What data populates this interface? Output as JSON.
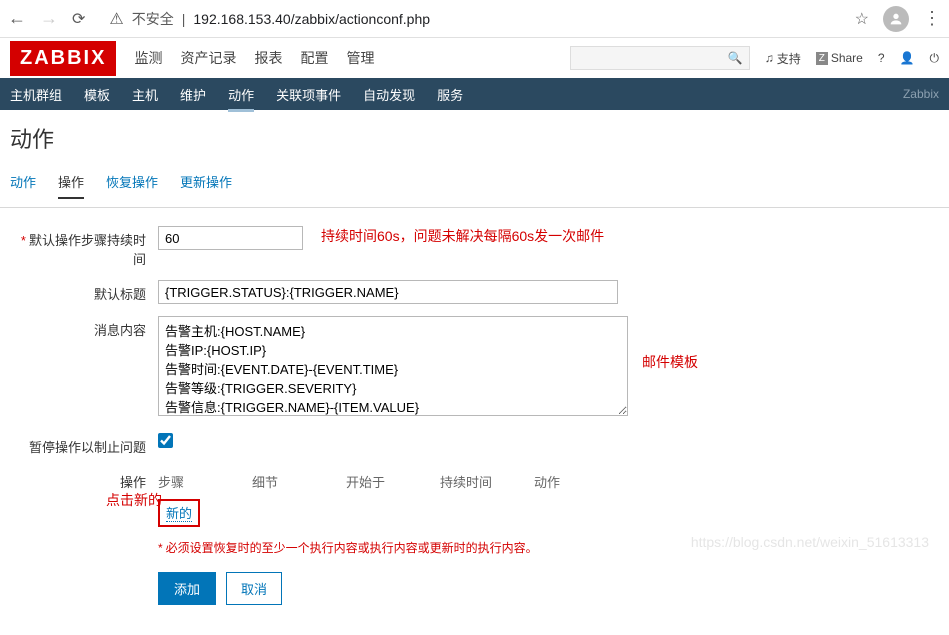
{
  "browser": {
    "security_label": "不安全",
    "url": "192.168.153.40/zabbix/actionconf.php"
  },
  "header": {
    "logo": "ZABBIX",
    "nav": [
      "监测",
      "资产记录",
      "报表",
      "配置",
      "管理"
    ],
    "support": "支持",
    "share": "Share"
  },
  "subnav": {
    "items": [
      "主机群组",
      "模板",
      "主机",
      "维护",
      "动作",
      "关联项事件",
      "自动发现",
      "服务"
    ],
    "right": "Zabbix"
  },
  "page_title": "动作",
  "tabs": [
    "动作",
    "操作",
    "恢复操作",
    "更新操作"
  ],
  "form": {
    "duration_label": "默认操作步骤持续时间",
    "duration_value": "60",
    "duration_note": "持续时间60s，问题未解决每隔60s发一次邮件",
    "subject_label": "默认标题",
    "subject_value": "{TRIGGER.STATUS}:{TRIGGER.NAME}",
    "message_label": "消息内容",
    "message_value": "告警主机:{HOST.NAME}\n告警IP:{HOST.IP}\n告警时间:{EVENT.DATE}-{EVENT.TIME}\n告警等级:{TRIGGER.SEVERITY}\n告警信息:{TRIGGER.NAME}-{ITEM.VALUE}\n事件ID:{EVENT.ID}",
    "message_note": "邮件模板",
    "pause_label": "暂停操作以制止问题",
    "ops_label": "操作",
    "ops_cols": [
      "步骤",
      "细节",
      "开始于",
      "持续时间",
      "动作"
    ],
    "ops_new": "新的",
    "ops_side_note": "点击新的",
    "hint": "必须设置恢复时的至少一个执行内容或执行内容或更新时的执行内容。",
    "btn_add": "添加",
    "btn_cancel": "取消"
  },
  "watermark": "https://blog.csdn.net/weixin_51613313"
}
